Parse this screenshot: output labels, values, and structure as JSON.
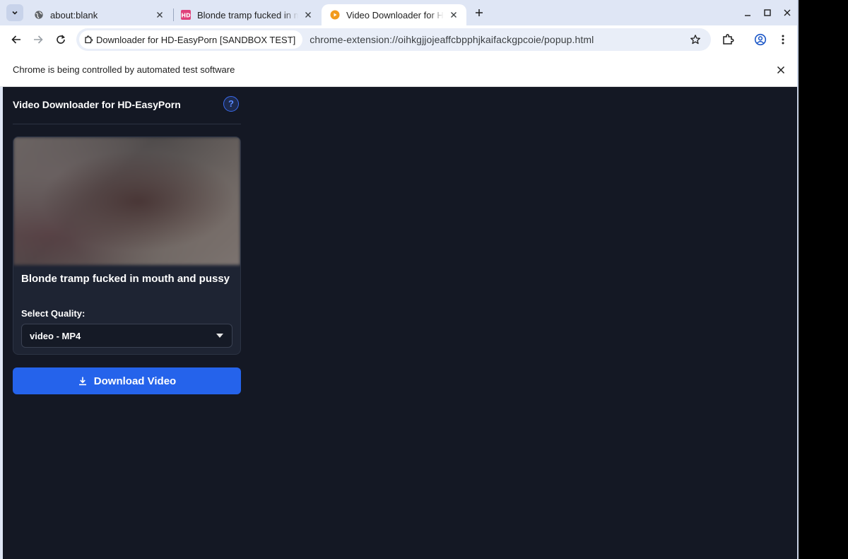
{
  "tabs": [
    {
      "title": "about:blank",
      "favicon": "globe-icon",
      "active": false
    },
    {
      "title": "Blonde tramp fucked in mouth and pussy",
      "favicon": "hd-site-icon",
      "active": false
    },
    {
      "title": "Video Downloader for HD-EasyPorn",
      "favicon": "extension-orange-icon",
      "active": true
    }
  ],
  "toolbar": {
    "site_chip": "Downloader for HD-EasyPorn [SANDBOX TEST]",
    "url": "chrome-extension://oihkgjjojeaffcbpphjkaifackgpcoie/popup.html"
  },
  "infobar": {
    "message": "Chrome is being controlled by automated test software"
  },
  "popup": {
    "title": "Video Downloader for HD-EasyPorn",
    "help_label": "?",
    "video_title": "Blonde tramp fucked in mouth and pussy",
    "quality_label": "Select Quality:",
    "quality_selected": "video - MP4",
    "download_label": "Download Video"
  },
  "colors": {
    "accent": "#2563eb",
    "background": "#141824",
    "card": "#1e2433"
  }
}
